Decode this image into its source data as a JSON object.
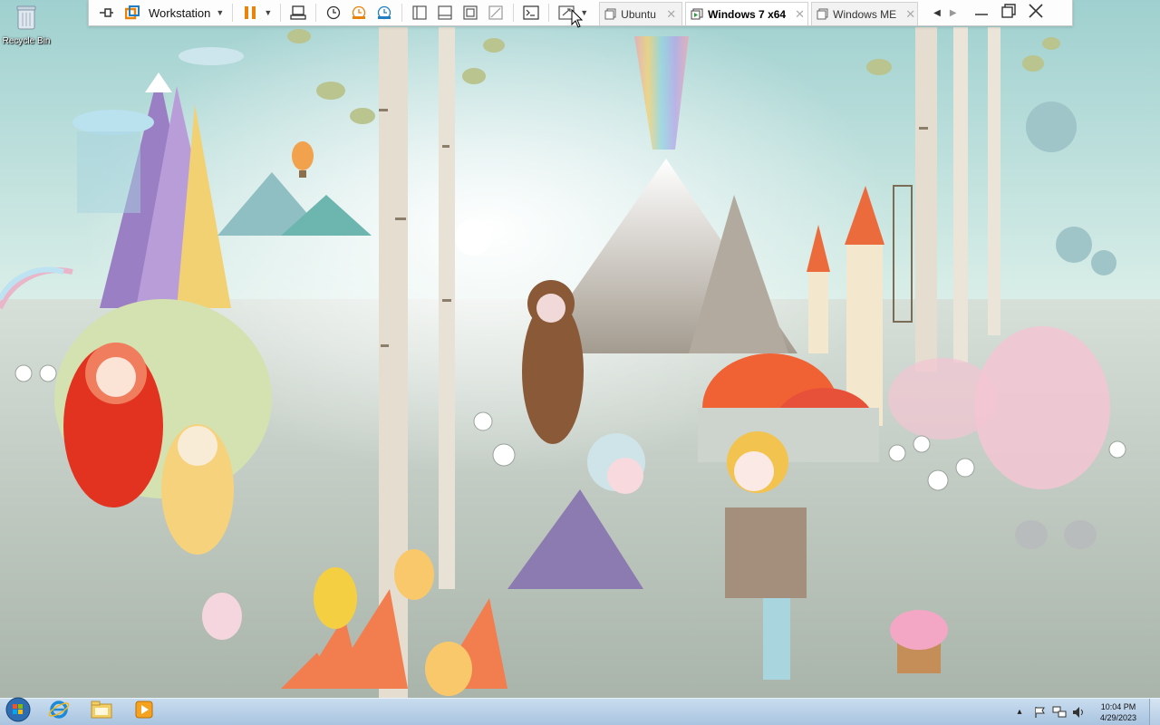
{
  "desktop": {
    "icons": [
      {
        "label": "Recycle Bin",
        "icon": "recycle-bin-icon"
      }
    ]
  },
  "vm_toolbar": {
    "product_menu_label": "Workstation",
    "tabs": [
      {
        "label": "Ubuntu",
        "active": false,
        "icon": "vm-tab-icon"
      },
      {
        "label": "Windows 7 x64",
        "active": true,
        "icon": "vm-running-icon"
      },
      {
        "label": "Windows ME",
        "active": false,
        "icon": "vm-tab-icon"
      }
    ],
    "close_glyph": "✕",
    "accent_color": "#e8830c"
  },
  "taskbar": {
    "start_icon": "windows-orb-icon",
    "pinned": [
      "internet-explorer-icon",
      "file-explorer-icon",
      "media-player-icon"
    ],
    "tray_arrow": "▴",
    "clock": {
      "time": "10:04 PM",
      "date": "4/29/2023"
    }
  }
}
